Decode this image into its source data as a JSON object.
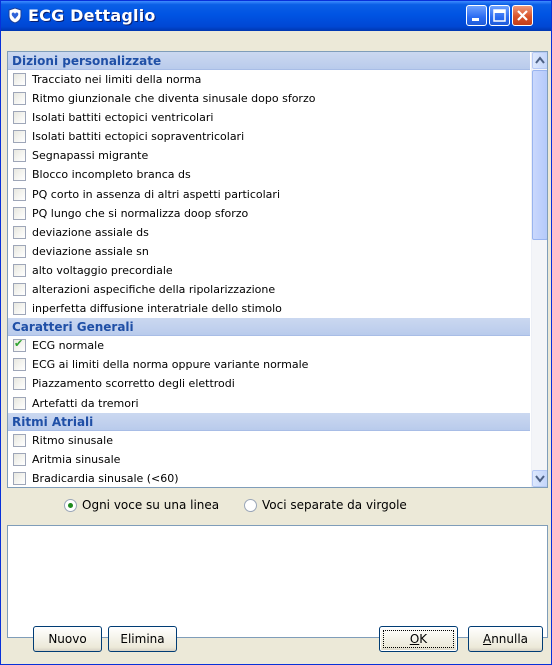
{
  "window": {
    "title": "ECG Dettaglio"
  },
  "groups": [
    {
      "header": "Dizioni personalizzate",
      "items": [
        {
          "label": "Tracciato nei limiti della norma",
          "checked": false
        },
        {
          "label": "Ritmo giunzionale che diventa sinusale dopo sforzo",
          "checked": false
        },
        {
          "label": "Isolati battiti ectopici ventricolari",
          "checked": false
        },
        {
          "label": "Isolati battiti ectopici sopraventricolari",
          "checked": false
        },
        {
          "label": "Segnapassi migrante",
          "checked": false
        },
        {
          "label": "Blocco incompleto branca ds",
          "checked": false
        },
        {
          "label": "PQ corto in assenza di altri aspetti particolari",
          "checked": false
        },
        {
          "label": "PQ lungo che si normalizza doop sforzo",
          "checked": false
        },
        {
          "label": "deviazione assiale ds",
          "checked": false
        },
        {
          "label": "deviazione assiale sn",
          "checked": false
        },
        {
          "label": "alto voltaggio precordiale",
          "checked": false
        },
        {
          "label": "alterazioni aspecifiche della ripolarizzazione",
          "checked": false
        },
        {
          "label": "inperfetta diffusione interatriale dello stimolo",
          "checked": false
        }
      ]
    },
    {
      "header": "Caratteri Generali",
      "items": [
        {
          "label": "ECG normale",
          "checked": true
        },
        {
          "label": "ECG ai limiti della norma oppure variante normale",
          "checked": false
        },
        {
          "label": "Piazzamento scorretto degli elettrodi",
          "checked": false
        },
        {
          "label": "Artefatti da tremori",
          "checked": false
        }
      ]
    },
    {
      "header": "Ritmi Atriali",
      "items": [
        {
          "label": "Ritmo sinusale",
          "checked": false
        },
        {
          "label": "Aritmia sinusale",
          "checked": false
        },
        {
          "label": "Bradicardia sinusale (<60)",
          "checked": false
        }
      ]
    }
  ],
  "format_options": {
    "one_per_line": "Ogni voce su una linea",
    "comma_separated": "Voci separate da virgole",
    "selected": "one_per_line"
  },
  "buttons": {
    "new": "Nuovo",
    "delete": "Elimina",
    "ok_mnemonic": "O",
    "ok_rest": "K",
    "cancel_mnemonic": "A",
    "cancel_rest": "nnulla"
  },
  "icons": {
    "app": "heart-shield-icon",
    "minimize": "minimize-icon",
    "maximize": "maximize-icon",
    "close": "close-icon",
    "scroll_up": "chevron-up-icon",
    "scroll_down": "chevron-down-icon"
  },
  "colors": {
    "titlebar": "#0054e3",
    "group_header_text": "#1f4fa6",
    "check": "#2fa32f",
    "close_button": "#d9542a"
  }
}
